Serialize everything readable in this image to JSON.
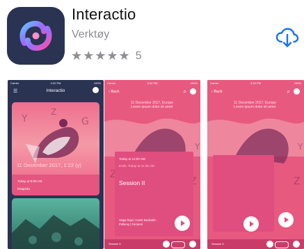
{
  "app": {
    "name": "Interactio",
    "developer": "Verktøy",
    "stars": "★★★★★",
    "rating_count": "5",
    "rating_value": 5
  },
  "colors": {
    "icon_bg": "#2a3352",
    "accent": "#1a73e8",
    "pink": "#e04e7f"
  },
  "screenshots": [
    {
      "status_left": "Carrier",
      "status_time": "3:32 PM",
      "status_right": "100%",
      "nav_title": "Interactio",
      "card_date": "11 December 2017, 1:22 (y)",
      "row1": "Today at 9:00 AM",
      "row2": "Klaipėda"
    },
    {
      "status_left": "Carrier",
      "status_time": "3:32 PM",
      "status_right": "100%",
      "back": "Back",
      "header1": "11 December 2017, Europe",
      "header2": "Lorem ipsum dolor sit amet",
      "date1": "Today at 11:00 AM",
      "date2": "Ends: Today at 11:45 AM",
      "session": "Session II",
      "speaker": "Vaiga Šapi | Carrie Beckwith - Pellerey | Fenturel",
      "bottom": "Session II"
    },
    {
      "status_left": "Carrier",
      "status_time": "3:32 PM",
      "status_right": "100%",
      "back": "Back",
      "header1": "11 December 2017, Europe",
      "header2": "Lorem ipsum dolor sit amet",
      "bottom": "Session II"
    }
  ]
}
